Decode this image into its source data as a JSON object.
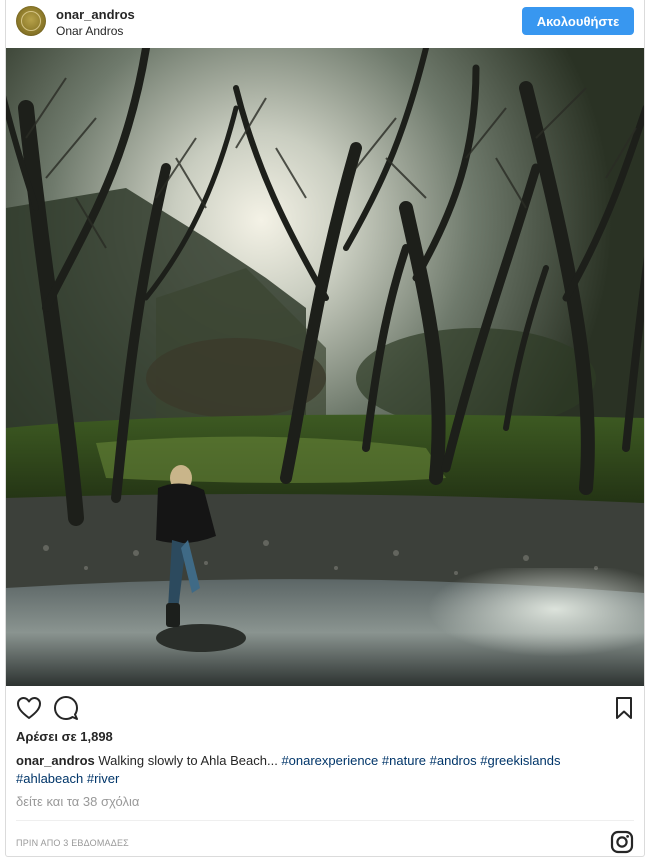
{
  "header": {
    "username": "onar_andros",
    "location": "Onar Andros",
    "follow_label": "Ακολουθήστε"
  },
  "photo": {
    "alt": "Person walking through a shallow river in a sunlit forest"
  },
  "actions": {
    "like_icon": "heart-icon",
    "comment_icon": "comment-icon",
    "save_icon": "bookmark-icon"
  },
  "likes_text": "Αρέσει σε 1,898",
  "caption": {
    "username": "onar_andros",
    "text": "Walking slowly to Ahla Beach...",
    "tags_line1": [
      "#onarexperience",
      "#nature",
      "#andros",
      "#greekislands"
    ],
    "tags_line2": [
      "#ahlabeach",
      "#river"
    ]
  },
  "view_comments": "δείτε και τα 38 σχόλια",
  "timestamp": "ΠΡΙΝ ΑΠΟ 3 ΕΒΔΟΜΑΔΕΣ",
  "footer_icon": "instagram-icon",
  "colors": {
    "follow_button": "#3897f0",
    "hashtag": "#003569",
    "muted": "#999999"
  }
}
